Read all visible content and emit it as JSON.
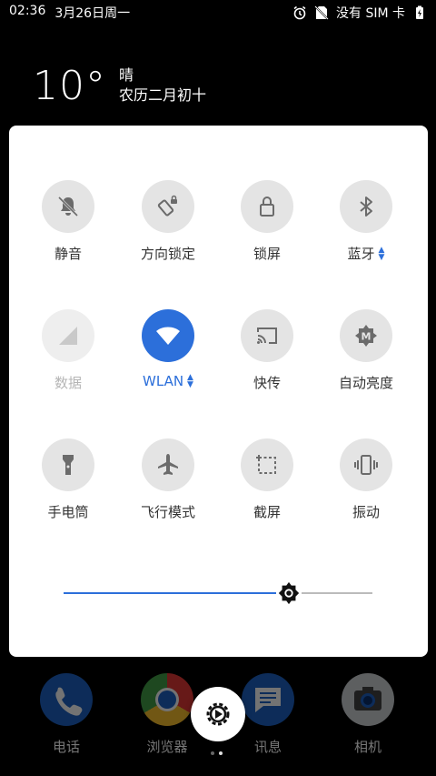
{
  "status_bar": {
    "time": "02:36",
    "date": "3月26日周一",
    "no_sim_text": "没有 SIM 卡",
    "icons": [
      "alarm-icon",
      "no-sim-icon",
      "battery-charging-icon"
    ]
  },
  "weather": {
    "temperature": "10°",
    "condition": "晴",
    "lunar_date": "农历二月初十"
  },
  "quick_settings": {
    "tiles": [
      {
        "label": "静音",
        "icon": "bell-off-icon",
        "state": "off"
      },
      {
        "label": "方向锁定",
        "icon": "rotation-lock-icon",
        "state": "off"
      },
      {
        "label": "锁屏",
        "icon": "lock-icon",
        "state": "off"
      },
      {
        "label": "蓝牙",
        "icon": "bluetooth-icon",
        "state": "off",
        "expandable": true
      },
      {
        "label": "数据",
        "icon": "signal-icon",
        "state": "disabled"
      },
      {
        "label": "WLAN",
        "icon": "wifi-icon",
        "state": "on",
        "expandable": true
      },
      {
        "label": "快传",
        "icon": "cast-icon",
        "state": "off"
      },
      {
        "label": "自动亮度",
        "icon": "auto-brightness-icon",
        "state": "off"
      },
      {
        "label": "手电筒",
        "icon": "flashlight-icon",
        "state": "off"
      },
      {
        "label": "飞行模式",
        "icon": "airplane-icon",
        "state": "off"
      },
      {
        "label": "截屏",
        "icon": "screenshot-icon",
        "state": "off"
      },
      {
        "label": "振动",
        "icon": "vibrate-icon",
        "state": "off"
      }
    ],
    "brightness": {
      "level_fraction": 0.73,
      "icon": "brightness-icon"
    }
  },
  "home_dock": {
    "apps": [
      {
        "label": "电话",
        "icon": "phone-icon"
      },
      {
        "label": "浏览器",
        "icon": "browser-icon"
      },
      {
        "label": "讯息",
        "icon": "message-icon"
      },
      {
        "label": "相机",
        "icon": "camera-icon"
      }
    ],
    "settings_icon": "settings-gear-icon",
    "page_count": 2,
    "active_page": 2
  },
  "colors": {
    "accent": "#2c6fda",
    "panel_bg": "#ffffff",
    "tile_bg": "#e4e4e4",
    "screen_bg": "#000000"
  }
}
